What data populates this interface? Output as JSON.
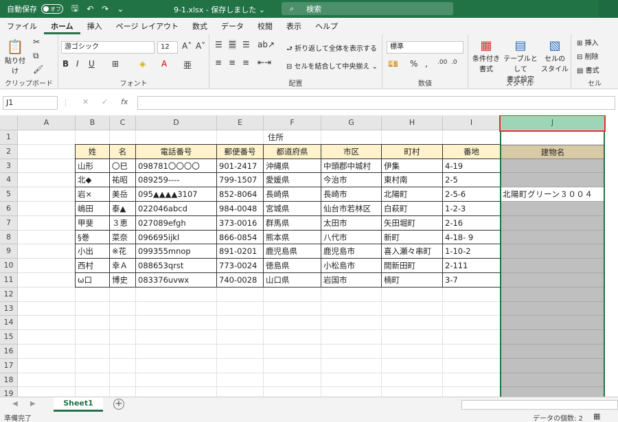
{
  "titlebar": {
    "autosave_label": "自動保存",
    "autosave_state": "オフ",
    "filename": "9-1.xlsx  -  保存しました  ⌄",
    "search_placeholder": "検索"
  },
  "tabs": [
    "ファイル",
    "ホーム",
    "挿入",
    "ページ レイアウト",
    "数式",
    "データ",
    "校閲",
    "表示",
    "ヘルプ"
  ],
  "active_tab": "ホーム",
  "ribbon": {
    "clipboard": {
      "paste": "貼り付け",
      "label": "クリップボード"
    },
    "font": {
      "family": "游ゴシック",
      "size": "12",
      "label": "フォント"
    },
    "alignment": {
      "wrap": "折り返して全体を表示する",
      "merge": "セルを結合して中央揃え",
      "label": "配置"
    },
    "number": {
      "format": "標準",
      "label": "数値"
    },
    "styles": {
      "conditional": "条件付き\n書式",
      "table": "テーブルとして\n書式設定",
      "cell": "セルの\nスタイル",
      "label": "スタイル"
    },
    "cells": {
      "insert": "挿入",
      "delete": "削除",
      "format": "書式",
      "label": "セル"
    }
  },
  "formula_bar": {
    "name_box": "J1",
    "fx": "fx",
    "value": ""
  },
  "columns": [
    "A",
    "B",
    "C",
    "D",
    "E",
    "F",
    "G",
    "H",
    "I",
    "J"
  ],
  "rows": [
    "1",
    "2",
    "3",
    "4",
    "5",
    "6",
    "7",
    "8",
    "9",
    "10",
    "11",
    "12",
    "13",
    "14",
    "15",
    "16",
    "17",
    "18",
    "19"
  ],
  "sheet": {
    "f1_label": "住所",
    "headers": [
      "姓",
      "名",
      "電話番号",
      "郵便番号",
      "都道府県",
      "市区",
      "町村",
      "番地"
    ],
    "j_header": "建物名",
    "data": [
      [
        "山形",
        "〇巳",
        "098781〇〇〇〇",
        "901-2417",
        "沖縄県",
        "中頭郡中城村",
        "伊集",
        "4-19",
        ""
      ],
      [
        "北◆",
        "祐昭",
        "089259----",
        "799-1507",
        "愛媛県",
        "今治市",
        "東村南",
        "2-5",
        ""
      ],
      [
        "岩×",
        "美岳",
        "095▲▲▲▲3107",
        "852-8064",
        "長崎県",
        "長崎市",
        "北陽町",
        "2-5-6",
        "北陽町グリーン３００４"
      ],
      [
        "嶋田",
        "泰▲",
        "022046abcd",
        "984-0048",
        "宮城県",
        "仙台市若林区",
        "白萩町",
        "1-2-3",
        ""
      ],
      [
        "甲斐",
        "３恵",
        "027089efgh",
        "373-0016",
        "群馬県",
        "太田市",
        "矢田堀町",
        "2-16",
        ""
      ],
      [
        "§巻",
        "菜奈",
        "096695ijkl",
        "866-0854",
        "熊本県",
        "八代市",
        "新町",
        "4-18- 9",
        ""
      ],
      [
        "小出",
        "※花",
        "099355mnop",
        "891-0201",
        "鹿児島県",
        "鹿児島市",
        "喜入瀬々串町",
        "1-10-2",
        ""
      ],
      [
        "西村",
        "幸Ａ",
        "088653qrst",
        "773-0024",
        "徳島県",
        "小松島市",
        "間新田町",
        "2-111",
        ""
      ],
      [
        "ω口",
        "博史",
        "083376uvwx",
        "740-0028",
        "山口県",
        "岩国市",
        "楠町",
        "3-7",
        ""
      ]
    ]
  },
  "sheet_tab": "Sheet1",
  "status": {
    "ready": "準備完了",
    "count": "データの個数: 2"
  }
}
